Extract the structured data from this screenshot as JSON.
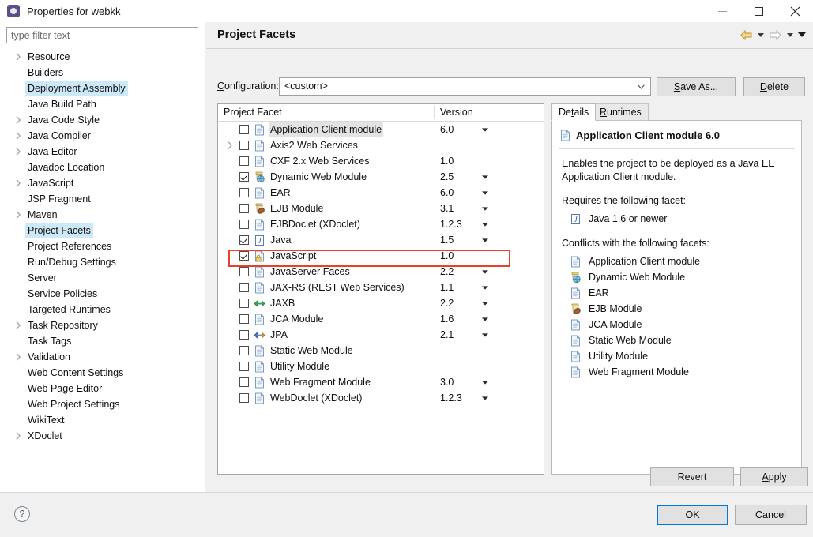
{
  "window": {
    "title": "Properties for webkk",
    "icon": "properties-gear-icon",
    "minimize_label": "Minimize",
    "maximize_label": "Maximize",
    "close_label": "Close"
  },
  "filter": {
    "placeholder": "type filter text",
    "value": ""
  },
  "sidebar": {
    "items": [
      {
        "label": "Resource",
        "expandable": true,
        "selected": false
      },
      {
        "label": "Builders",
        "expandable": false,
        "selected": false
      },
      {
        "label": "Deployment Assembly",
        "expandable": false,
        "selected": true
      },
      {
        "label": "Java Build Path",
        "expandable": false,
        "selected": false
      },
      {
        "label": "Java Code Style",
        "expandable": true,
        "selected": false
      },
      {
        "label": "Java Compiler",
        "expandable": true,
        "selected": false
      },
      {
        "label": "Java Editor",
        "expandable": true,
        "selected": false
      },
      {
        "label": "Javadoc Location",
        "expandable": false,
        "selected": false
      },
      {
        "label": "JavaScript",
        "expandable": true,
        "selected": false
      },
      {
        "label": "JSP Fragment",
        "expandable": false,
        "selected": false
      },
      {
        "label": "Maven",
        "expandable": true,
        "selected": false
      },
      {
        "label": "Project Facets",
        "expandable": false,
        "selected": true
      },
      {
        "label": "Project References",
        "expandable": false,
        "selected": false
      },
      {
        "label": "Run/Debug Settings",
        "expandable": false,
        "selected": false
      },
      {
        "label": "Server",
        "expandable": false,
        "selected": false
      },
      {
        "label": "Service Policies",
        "expandable": false,
        "selected": false
      },
      {
        "label": "Targeted Runtimes",
        "expandable": false,
        "selected": false
      },
      {
        "label": "Task Repository",
        "expandable": true,
        "selected": false
      },
      {
        "label": "Task Tags",
        "expandable": false,
        "selected": false
      },
      {
        "label": "Validation",
        "expandable": true,
        "selected": false
      },
      {
        "label": "Web Content Settings",
        "expandable": false,
        "selected": false
      },
      {
        "label": "Web Page Editor",
        "expandable": false,
        "selected": false
      },
      {
        "label": "Web Project Settings",
        "expandable": false,
        "selected": false
      },
      {
        "label": "WikiText",
        "expandable": false,
        "selected": false
      },
      {
        "label": "XDoclet",
        "expandable": true,
        "selected": false
      }
    ]
  },
  "page": {
    "title": "Project Facets",
    "nav": {
      "back_icon": "back-arrow-icon",
      "back_menu_icon": "chevron-down-icon",
      "forward_icon": "forward-arrow-icon",
      "forward_menu_icon": "chevron-down-icon",
      "menu_icon": "chevron-down-icon"
    }
  },
  "configuration": {
    "label": "Configuration:",
    "label_mnemonic": "C",
    "value": "<custom>",
    "save_as_label": "Save As...",
    "save_as_mnemonic": "S",
    "delete_label": "Delete",
    "delete_mnemonic": "D"
  },
  "facets_table": {
    "columns": [
      "Project Facet",
      "Version"
    ],
    "highlight_color": "#e8402a",
    "highlighted_row": "Dynamic Web Module",
    "rows": [
      {
        "name": "Application Client module",
        "version": "6.0",
        "checked": false,
        "has_dropdown": true,
        "expandable": false,
        "icon": "document-icon",
        "shaded": true
      },
      {
        "name": "Axis2 Web Services",
        "version": "",
        "checked": false,
        "has_dropdown": false,
        "expandable": true,
        "icon": "document-icon",
        "shaded": false
      },
      {
        "name": "CXF 2.x Web Services",
        "version": "1.0",
        "checked": false,
        "has_dropdown": false,
        "expandable": false,
        "icon": "document-icon",
        "shaded": false
      },
      {
        "name": "Dynamic Web Module",
        "version": "2.5",
        "checked": true,
        "has_dropdown": true,
        "expandable": false,
        "icon": "web-module-icon",
        "shaded": false
      },
      {
        "name": "EAR",
        "version": "6.0",
        "checked": false,
        "has_dropdown": true,
        "expandable": false,
        "icon": "document-icon",
        "shaded": false
      },
      {
        "name": "EJB Module",
        "version": "3.1",
        "checked": false,
        "has_dropdown": true,
        "expandable": false,
        "icon": "ejb-module-icon",
        "shaded": false
      },
      {
        "name": "EJBDoclet (XDoclet)",
        "version": "1.2.3",
        "checked": false,
        "has_dropdown": true,
        "expandable": false,
        "icon": "document-icon",
        "shaded": false
      },
      {
        "name": "Java",
        "version": "1.5",
        "checked": true,
        "has_dropdown": true,
        "expandable": false,
        "icon": "java-icon",
        "shaded": false
      },
      {
        "name": "JavaScript",
        "version": "1.0",
        "checked": true,
        "has_dropdown": false,
        "expandable": false,
        "icon": "javascript-lock-icon",
        "shaded": false
      },
      {
        "name": "JavaServer Faces",
        "version": "2.2",
        "checked": false,
        "has_dropdown": true,
        "expandable": false,
        "icon": "document-icon",
        "shaded": false
      },
      {
        "name": "JAX-RS (REST Web Services)",
        "version": "1.1",
        "checked": false,
        "has_dropdown": true,
        "expandable": false,
        "icon": "document-icon",
        "shaded": false
      },
      {
        "name": "JAXB",
        "version": "2.2",
        "checked": false,
        "has_dropdown": true,
        "expandable": false,
        "icon": "jaxb-arrows-icon",
        "shaded": false
      },
      {
        "name": "JCA Module",
        "version": "1.6",
        "checked": false,
        "has_dropdown": true,
        "expandable": false,
        "icon": "document-icon",
        "shaded": false
      },
      {
        "name": "JPA",
        "version": "2.1",
        "checked": false,
        "has_dropdown": true,
        "expandable": false,
        "icon": "jpa-arrows-icon",
        "shaded": false
      },
      {
        "name": "Static Web Module",
        "version": "",
        "checked": false,
        "has_dropdown": false,
        "expandable": false,
        "icon": "document-icon",
        "shaded": false
      },
      {
        "name": "Utility Module",
        "version": "",
        "checked": false,
        "has_dropdown": false,
        "expandable": false,
        "icon": "document-icon",
        "shaded": false
      },
      {
        "name": "Web Fragment Module",
        "version": "3.0",
        "checked": false,
        "has_dropdown": true,
        "expandable": false,
        "icon": "document-icon",
        "shaded": false
      },
      {
        "name": "WebDoclet (XDoclet)",
        "version": "1.2.3",
        "checked": false,
        "has_dropdown": true,
        "expandable": false,
        "icon": "document-icon",
        "shaded": false
      }
    ]
  },
  "details": {
    "tabs": [
      {
        "label": "Details",
        "mnemonic": "t",
        "active": true
      },
      {
        "label": "Runtimes",
        "mnemonic": "R",
        "active": false
      }
    ],
    "heading": "Application Client module 6.0",
    "heading_icon": "document-icon",
    "description": "Enables the project to be deployed as a Java EE Application Client module.",
    "requires_label": "Requires the following facet:",
    "requires": [
      {
        "label": "Java 1.6 or newer",
        "icon": "java-icon"
      }
    ],
    "conflicts_label": "Conflicts with the following facets:",
    "conflicts": [
      {
        "label": "Application Client module",
        "icon": "document-icon"
      },
      {
        "label": "Dynamic Web Module",
        "icon": "web-module-icon"
      },
      {
        "label": "EAR",
        "icon": "document-icon"
      },
      {
        "label": "EJB Module",
        "icon": "ejb-module-icon"
      },
      {
        "label": "JCA Module",
        "icon": "document-icon"
      },
      {
        "label": "Static Web Module",
        "icon": "document-icon"
      },
      {
        "label": "Utility Module",
        "icon": "document-icon"
      },
      {
        "label": "Web Fragment Module",
        "icon": "document-icon"
      }
    ]
  },
  "footer": {
    "help_label": "?",
    "revert_label": "Revert",
    "apply_label": "Apply",
    "apply_mnemonic": "A",
    "ok_label": "OK",
    "cancel_label": "Cancel",
    "default_button": "OK",
    "focus_color": "#0078d7"
  }
}
